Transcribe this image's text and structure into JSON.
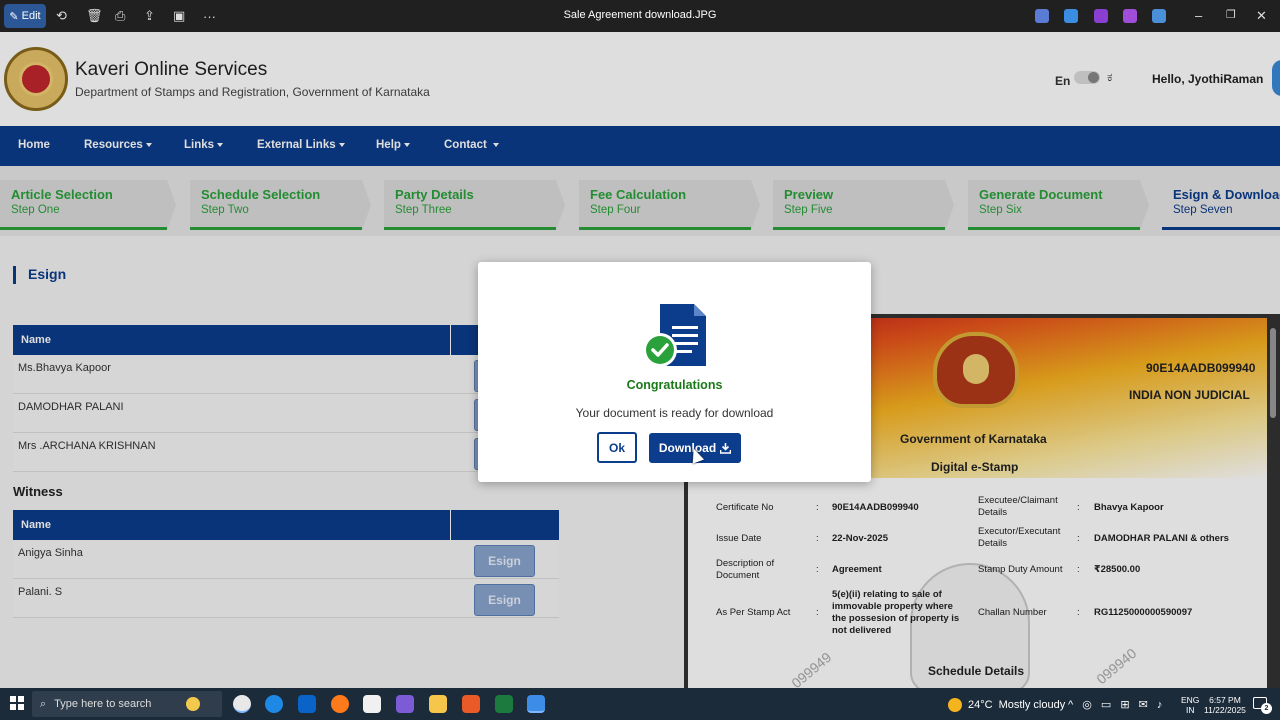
{
  "titlebar": {
    "edit_label": "Edit",
    "window_title": "Sale Agreement download.JPG",
    "more_label": "···",
    "minimize": "–",
    "maximize": "❐",
    "close": "✕"
  },
  "header": {
    "site_title": "Kaveri Online Services",
    "site_subtitle": "Department of Stamps and Registration, Government of Karnataka",
    "lang_en": "En",
    "lang_kn": "ಕ",
    "greeting": "Hello, JyothiRaman"
  },
  "nav": {
    "items": [
      {
        "label": "Home",
        "dropdown": false
      },
      {
        "label": "Resources",
        "dropdown": true
      },
      {
        "label": "Links",
        "dropdown": true
      },
      {
        "label": "External Links",
        "dropdown": true
      },
      {
        "label": "Help",
        "dropdown": true
      },
      {
        "label": "Contact",
        "dropdown": true
      }
    ]
  },
  "steps": [
    {
      "title": "Article Selection",
      "sub": "Step One",
      "state": "done"
    },
    {
      "title": "Schedule Selection",
      "sub": "Step Two",
      "state": "done"
    },
    {
      "title": "Party Details",
      "sub": "Step Three",
      "state": "done"
    },
    {
      "title": "Fee Calculation",
      "sub": "Step Four",
      "state": "done"
    },
    {
      "title": "Preview",
      "sub": "Step Five",
      "state": "done"
    },
    {
      "title": "Generate Document",
      "sub": "Step Six",
      "state": "done"
    },
    {
      "title": "Esign & Download",
      "sub": "Step Seven",
      "state": "active"
    }
  ],
  "esign": {
    "heading": "Esign",
    "column_name": "Name",
    "parties": [
      "Ms.Bhavya Kapoor",
      "DAMODHAR PALANI",
      "Mrs .ARCHANA KRISHNAN"
    ],
    "witness_heading": "Witness",
    "witness_column_name": "Name",
    "witnesses": [
      "Anigya Sinha",
      "Palani. S"
    ],
    "button_label": "Esign"
  },
  "stamp": {
    "certificate_code": "90E14AADB099940",
    "non_judicial": "INDIA NON JUDICIAL",
    "government": "Government of Karnataka",
    "digital": "Digital e-Stamp",
    "fields": [
      {
        "label": "Certificate No",
        "value": "90E14AADB099940"
      },
      {
        "label": "Issue Date",
        "value": "22-Nov-2025"
      },
      {
        "label": "Description of Document",
        "value": "Agreement"
      },
      {
        "label": "As Per Stamp Act",
        "value": "5(e)(ii) relating to sale of immovable property where the possesion of property is not delivered"
      }
    ],
    "fields_right": [
      {
        "label": "Executee/Claimant Details",
        "value": "Bhavya Kapoor"
      },
      {
        "label": "Executor/Executant Details",
        "value": "DAMODHAR PALANI & others"
      },
      {
        "label": "Stamp Duty Amount",
        "value": "₹28500.00"
      },
      {
        "label": "Challan Number",
        "value": "RG1125000000590097"
      }
    ],
    "separator": ":",
    "watermark": "099949",
    "watermark2": "099940",
    "schedule": "Schedule Details"
  },
  "modal": {
    "title": "Congratulations",
    "message": "Your document is ready for download",
    "ok_label": "Ok",
    "download_label": "Download"
  },
  "taskbar": {
    "search_placeholder": "Type here to search",
    "weather_temp": "24°C",
    "weather_text": "Mostly cloudy",
    "lang1": "ENG",
    "lang2": "IN",
    "time": "6:57 PM",
    "date": "11/22/2025",
    "notif_count": "2"
  },
  "colors": {
    "nav_blue": "#0c3c8c",
    "step_green": "#2aa13a",
    "congrats_green": "#1a7a1a"
  }
}
